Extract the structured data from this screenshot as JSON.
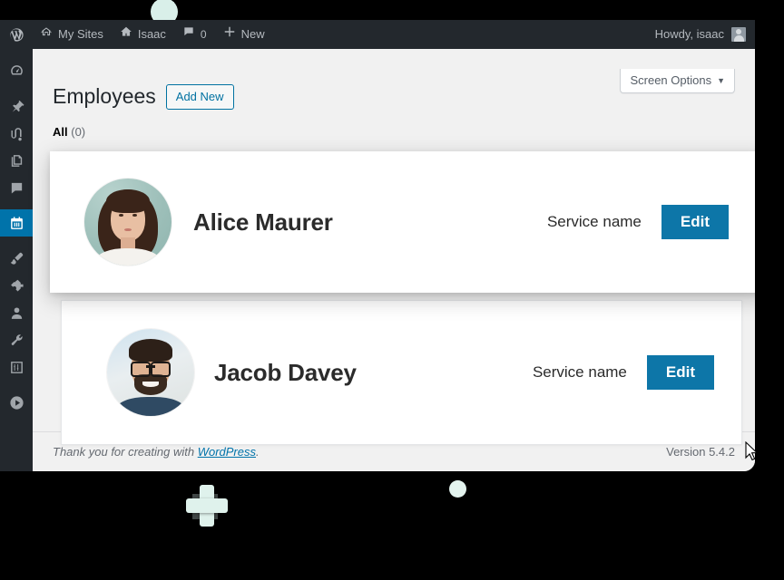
{
  "adminbar": {
    "logo_icon": "wordpress-logo-icon",
    "items": [
      {
        "label": "My Sites",
        "icon": "multisite-icon"
      },
      {
        "label": "Isaac",
        "icon": "home-icon"
      },
      {
        "label": "0",
        "icon": "comment-bubble-icon"
      },
      {
        "label": "New",
        "icon": "plus-icon"
      }
    ],
    "howdy": "Howdy, isaac",
    "avatar_icon": "user-avatar-icon"
  },
  "sidebar": {
    "items": [
      {
        "name": "dashboard",
        "icon": "dashboard-icon",
        "current": false
      },
      {
        "name": "posts",
        "icon": "pin-icon",
        "current": false
      },
      {
        "name": "media",
        "icon": "media-icon",
        "current": false
      },
      {
        "name": "pages",
        "icon": "pages-icon",
        "current": false
      },
      {
        "name": "comments",
        "icon": "comment-icon",
        "current": false
      },
      {
        "name": "bookings",
        "icon": "calendar-icon",
        "current": true
      },
      {
        "name": "appearance",
        "icon": "paintbrush-icon",
        "current": false
      },
      {
        "name": "plugins",
        "icon": "plugin-icon",
        "current": false
      },
      {
        "name": "users",
        "icon": "user-icon",
        "current": false
      },
      {
        "name": "tools",
        "icon": "wrench-icon",
        "current": false
      },
      {
        "name": "settings",
        "icon": "settings-sliders-icon",
        "current": false
      },
      {
        "name": "collapse",
        "icon": "play-circle-icon",
        "current": false
      }
    ]
  },
  "screen_meta": {
    "label": "Screen Options",
    "caret": "▼"
  },
  "page": {
    "title": "Employees",
    "add_new_label": "Add New",
    "filter_label": "All",
    "filter_count": "(0)"
  },
  "employees": [
    {
      "name": "Alice Maurer",
      "service": "Service name",
      "edit_label": "Edit",
      "avatar_icon": "employee-avatar-alice"
    },
    {
      "name": "Jacob Davey",
      "service": "Service name",
      "edit_label": "Edit",
      "avatar_icon": "employee-avatar-jacob"
    }
  ],
  "footer": {
    "thanks_prefix": "Thank you for creating with ",
    "link_label": "WordPress",
    "thanks_suffix": ".",
    "version": "Version 5.4.2"
  },
  "colors": {
    "admin_blue": "#0073aa",
    "edit_button": "#0d76a8",
    "admin_dark": "#23282d",
    "content_bg": "#f1f1f1",
    "accent_mint": "#d9efe9"
  }
}
